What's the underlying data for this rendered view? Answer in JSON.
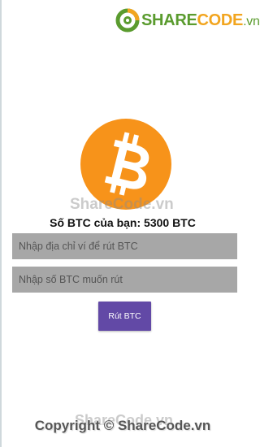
{
  "brand": {
    "share": "SHARE",
    "code": "CODE",
    "vn": ".vn",
    "icon": "sharecode-logo-icon"
  },
  "watermark": {
    "mid": "ShareCode.vn",
    "bottom": "ShareCode.vn"
  },
  "wallet": {
    "logo_icon": "bitcoin-icon",
    "balance_text": "Số BTC của bạn: 5300 BTC"
  },
  "form": {
    "address_placeholder": "Nhập địa chỉ ví để rút BTC",
    "amount_placeholder": "Nhập số BTC muốn rút",
    "withdraw_label": "Rút BTC"
  },
  "footer": {
    "copyright": "Copyright © ShareCode.vn"
  },
  "colors": {
    "bitcoin_orange": "#f7931a",
    "button_purple": "#6249a6",
    "field_gray": "#a7a7a7",
    "brand_green": "#5a9b2e",
    "brand_orange": "#f2a51f"
  }
}
